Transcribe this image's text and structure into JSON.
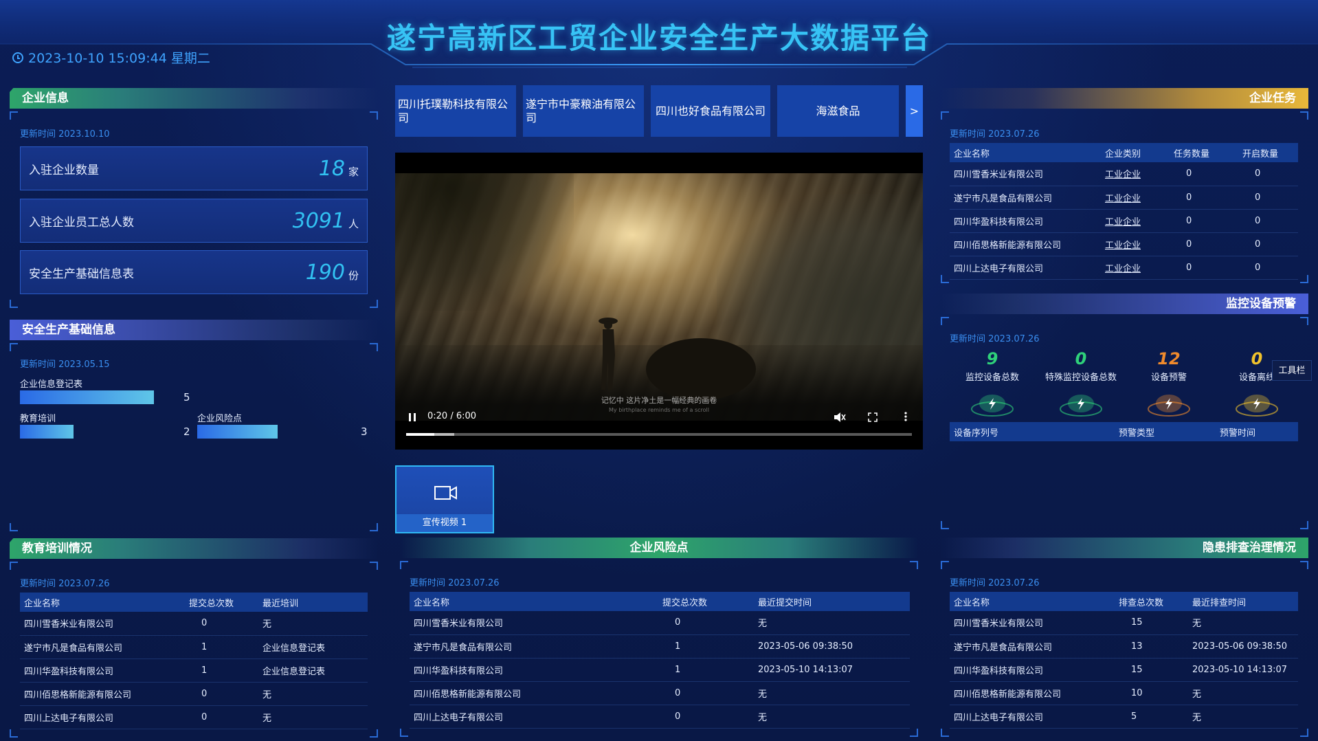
{
  "header": {
    "title": "遂宁高新区工贸企业安全生产大数据平台",
    "datetime": "2023-10-10 15:09:44 星期二"
  },
  "enterprise_info": {
    "title": "企业信息",
    "updated": "更新时间 2023.10.10",
    "stats": [
      {
        "label": "入驻企业数量",
        "value": "18",
        "unit": "家"
      },
      {
        "label": "入驻企业员工总人数",
        "value": "3091",
        "unit": "人"
      },
      {
        "label": "安全生产基础信息表",
        "value": "190",
        "unit": "份"
      }
    ]
  },
  "safety_basic": {
    "title": "安全生产基础信息",
    "updated": "更新时间 2023.05.15",
    "bars": [
      {
        "label": "企业信息登记表",
        "value": 5
      },
      {
        "label": "教育培训",
        "value": 2
      },
      {
        "label": "企业风险点",
        "value": 3
      }
    ]
  },
  "company_tabs": {
    "tabs": [
      "四川托璞勒科技有限公司",
      "遂宁市中豪粮油有限公司",
      "四川也好食品有限公司",
      "海滋食品"
    ],
    "next": ">"
  },
  "video": {
    "time": "0:20 / 6:00",
    "progress": 0.0556,
    "buffered": 0.095,
    "subtitle_cn": "记忆中  这片净土是一幅经典的画卷",
    "subtitle_en": "My birthplace reminds me of a scroll",
    "thumb_label": "宣传视频 1"
  },
  "enterprise_tasks": {
    "title": "企业任务",
    "updated": "更新时间 2023.07.26",
    "columns": [
      "企业名称",
      "企业类别",
      "任务数量",
      "开启数量"
    ],
    "rows": [
      [
        "四川雪香米业有限公司",
        "工业企业",
        "0",
        "0"
      ],
      [
        "遂宁市凡是食品有限公司",
        "工业企业",
        "0",
        "0"
      ],
      [
        "四川华盈科技有限公司",
        "工业企业",
        "0",
        "0"
      ],
      [
        "四川佰思格新能源有限公司",
        "工业企业",
        "0",
        "0"
      ],
      [
        "四川上达电子有限公司",
        "工业企业",
        "0",
        "0"
      ]
    ]
  },
  "monitor": {
    "title": "监控设备预警",
    "updated": "更新时间 2023.07.26",
    "items": [
      {
        "value": "9",
        "label": "监控设备总数",
        "color": "#2fd17a"
      },
      {
        "value": "0",
        "label": "特殊监控设备总数",
        "color": "#2fd17a"
      },
      {
        "value": "12",
        "label": "设备预警",
        "color": "#f08a2c"
      },
      {
        "value": "0",
        "label": "设备离线",
        "color": "#f0c22c"
      }
    ],
    "columns": [
      "设备序列号",
      "预警类型",
      "预警时间"
    ],
    "toolbar": "工具栏"
  },
  "education": {
    "title": "教育培训情况",
    "updated": "更新时间 2023.07.26",
    "columns": [
      "企业名称",
      "提交总次数",
      "最近培训"
    ],
    "rows": [
      [
        "四川雪香米业有限公司",
        "0",
        "无"
      ],
      [
        "遂宁市凡是食品有限公司",
        "1",
        "企业信息登记表"
      ],
      [
        "四川华盈科技有限公司",
        "1",
        "企业信息登记表"
      ],
      [
        "四川佰思格新能源有限公司",
        "0",
        "无"
      ],
      [
        "四川上达电子有限公司",
        "0",
        "无"
      ]
    ]
  },
  "risk_points": {
    "title": "企业风险点",
    "updated": "更新时间 2023.07.26",
    "columns": [
      "企业名称",
      "提交总次数",
      "最近提交时间"
    ],
    "rows": [
      [
        "四川雪香米业有限公司",
        "0",
        "无"
      ],
      [
        "遂宁市凡是食品有限公司",
        "1",
        "2023-05-06 09:38:50"
      ],
      [
        "四川华盈科技有限公司",
        "1",
        "2023-05-10 14:13:07"
      ],
      [
        "四川佰思格新能源有限公司",
        "0",
        "无"
      ],
      [
        "四川上达电子有限公司",
        "0",
        "无"
      ]
    ]
  },
  "hazard": {
    "title": "隐患排查治理情况",
    "updated": "更新时间 2023.07.26",
    "columns": [
      "企业名称",
      "排查总次数",
      "最近排查时间"
    ],
    "rows": [
      [
        "四川雪香米业有限公司",
        "15",
        "无"
      ],
      [
        "遂宁市凡是食品有限公司",
        "13",
        "2023-05-06 09:38:50"
      ],
      [
        "四川华盈科技有限公司",
        "15",
        "2023-05-10 14:13:07"
      ],
      [
        "四川佰思格新能源有限公司",
        "10",
        "无"
      ],
      [
        "四川上达电子有限公司",
        "5",
        "无"
      ]
    ]
  }
}
